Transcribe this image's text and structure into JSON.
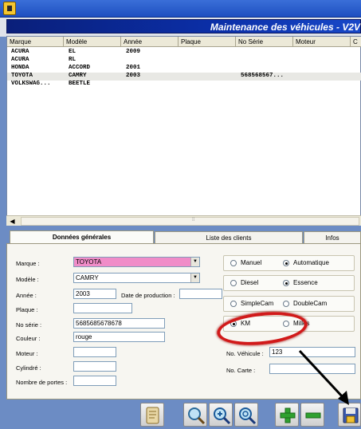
{
  "window": {
    "header_title": "Maintenance des véhicules - V2V"
  },
  "list": {
    "columns": [
      "Marque",
      "Modèle",
      "Année",
      "Plaque",
      "No Série",
      "Moteur",
      "C"
    ],
    "rows": [
      {
        "marque": "ACURA",
        "modele": "EL",
        "annee": "2009",
        "plaque": "",
        "serie": "",
        "moteur": ""
      },
      {
        "marque": "ACURA",
        "modele": "RL",
        "annee": "",
        "plaque": "",
        "serie": "",
        "moteur": ""
      },
      {
        "marque": "HONDA",
        "modele": "ACCORD",
        "annee": "2001",
        "plaque": "",
        "serie": "",
        "moteur": ""
      },
      {
        "marque": "TOYOTA",
        "modele": "CAMRY",
        "annee": "2003",
        "plaque": "",
        "serie": "568568567...",
        "moteur": ""
      },
      {
        "marque": "VOLKSWAG...",
        "modele": "BEETLE",
        "annee": "",
        "plaque": "",
        "serie": "",
        "moteur": ""
      }
    ],
    "selected_row": 3
  },
  "tabs": [
    "Données générales",
    "Liste des clients",
    "Infos"
  ],
  "form": {
    "marque_label": "Marque :",
    "marque_value": "TOYOTA",
    "modele_label": "Modèle :",
    "modele_value": "CAMRY",
    "annee_label": "Année :",
    "annee_value": "2003",
    "date_production_label": "Date de production :",
    "date_production_value": "",
    "plaque_label": "Plaque :",
    "plaque_value": "",
    "no_serie_label": "No série :",
    "no_serie_value": "5685685678678",
    "couleur_label": "Couleur :",
    "couleur_value": "rouge",
    "moteur_label": "Moteur :",
    "moteur_value": "",
    "cylindre_label": "Cylindré :",
    "cylindre_value": "",
    "portes_label": "Nombre de portes :",
    "portes_value": "",
    "no_vehicule_label": "No. Véhicule :",
    "no_vehicule_value": "123",
    "no_carte_label": "No. Carte :",
    "no_carte_value": ""
  },
  "options": {
    "transmission": {
      "a": "Manuel",
      "b": "Automatique",
      "selected": "b"
    },
    "carburant": {
      "a": "Diesel",
      "b": "Essence",
      "selected": "b"
    },
    "cam": {
      "a": "SimpleCam",
      "b": "DoubleCam",
      "selected": ""
    },
    "distance": {
      "a": "KM",
      "b": "Milles",
      "selected": "a"
    }
  },
  "colors": {
    "header_bg": "#0b2fa8",
    "marque_highlight": "#f08cc8",
    "annotation_red": "#d11a1a",
    "background": "#6c8cc4"
  },
  "toolbar": {
    "icons": [
      "scroll-icon",
      "search-icon",
      "zoom-in-icon",
      "zoom-out-icon",
      "add-icon",
      "remove-icon",
      "save-icon"
    ]
  }
}
